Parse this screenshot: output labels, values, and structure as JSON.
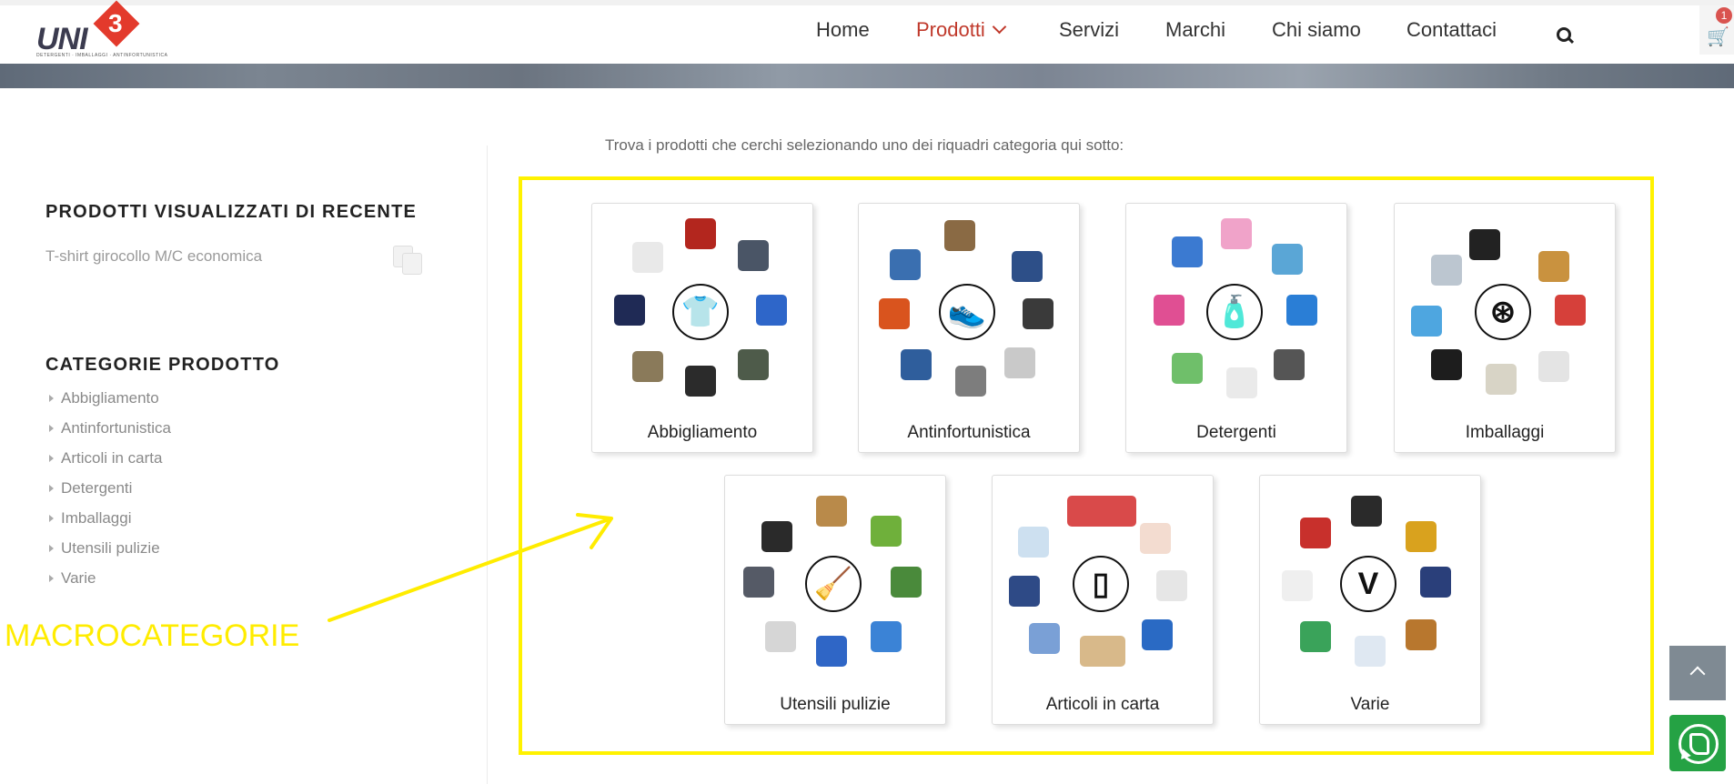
{
  "header": {
    "logo_text": "UNI",
    "logo_number": "3",
    "logo_tagline": "DETERGENTI · IMBALLAGGI · ANTINFORTUNISTICA",
    "nav": [
      {
        "label": "Home",
        "active": false
      },
      {
        "label": "Prodotti",
        "active": true
      },
      {
        "label": "Servizi",
        "active": false
      },
      {
        "label": "Marchi",
        "active": false
      },
      {
        "label": "Chi siamo",
        "active": false
      },
      {
        "label": "Contattaci",
        "active": false
      }
    ],
    "cart_count": "1",
    "accent_color": "#c0392b"
  },
  "sidebar": {
    "recent_title": "PRODOTTI VISUALIZZATI DI RECENTE",
    "recent_items": [
      {
        "label": "T-shirt girocollo M/C economica"
      }
    ],
    "categories_title": "CATEGORIE PRODOTTO",
    "categories": [
      "Abbigliamento",
      "Antinfortunistica",
      "Articoli in carta",
      "Detergenti",
      "Imballaggi",
      "Utensili pulizie",
      "Varie"
    ]
  },
  "main": {
    "intro": "Trova i prodotti che cerchi selezionando uno dei riquadri categoria qui sotto:",
    "cards": [
      {
        "label": "Abbigliamento",
        "icon": "t-shirt-icon",
        "glyph": "👕"
      },
      {
        "label": "Antinfortunistica",
        "icon": "safety-shoe-icon",
        "glyph": "👟"
      },
      {
        "label": "Detergenti",
        "icon": "detergent-bottle-icon",
        "glyph": "🧴"
      },
      {
        "label": "Imballaggi",
        "icon": "tape-dispenser-icon",
        "glyph": "⊛"
      },
      {
        "label": "Utensili pulizie",
        "icon": "mop-bucket-icon",
        "glyph": "🧹"
      },
      {
        "label": "Articoli in carta",
        "icon": "paper-roll-icon",
        "glyph": "▯"
      },
      {
        "label": "Varie",
        "icon": "letter-v-icon",
        "glyph": "V"
      }
    ],
    "frame_color": "#fff200"
  },
  "annotation": {
    "label": "MACROCATEGORIE",
    "color": "#ffec00"
  }
}
